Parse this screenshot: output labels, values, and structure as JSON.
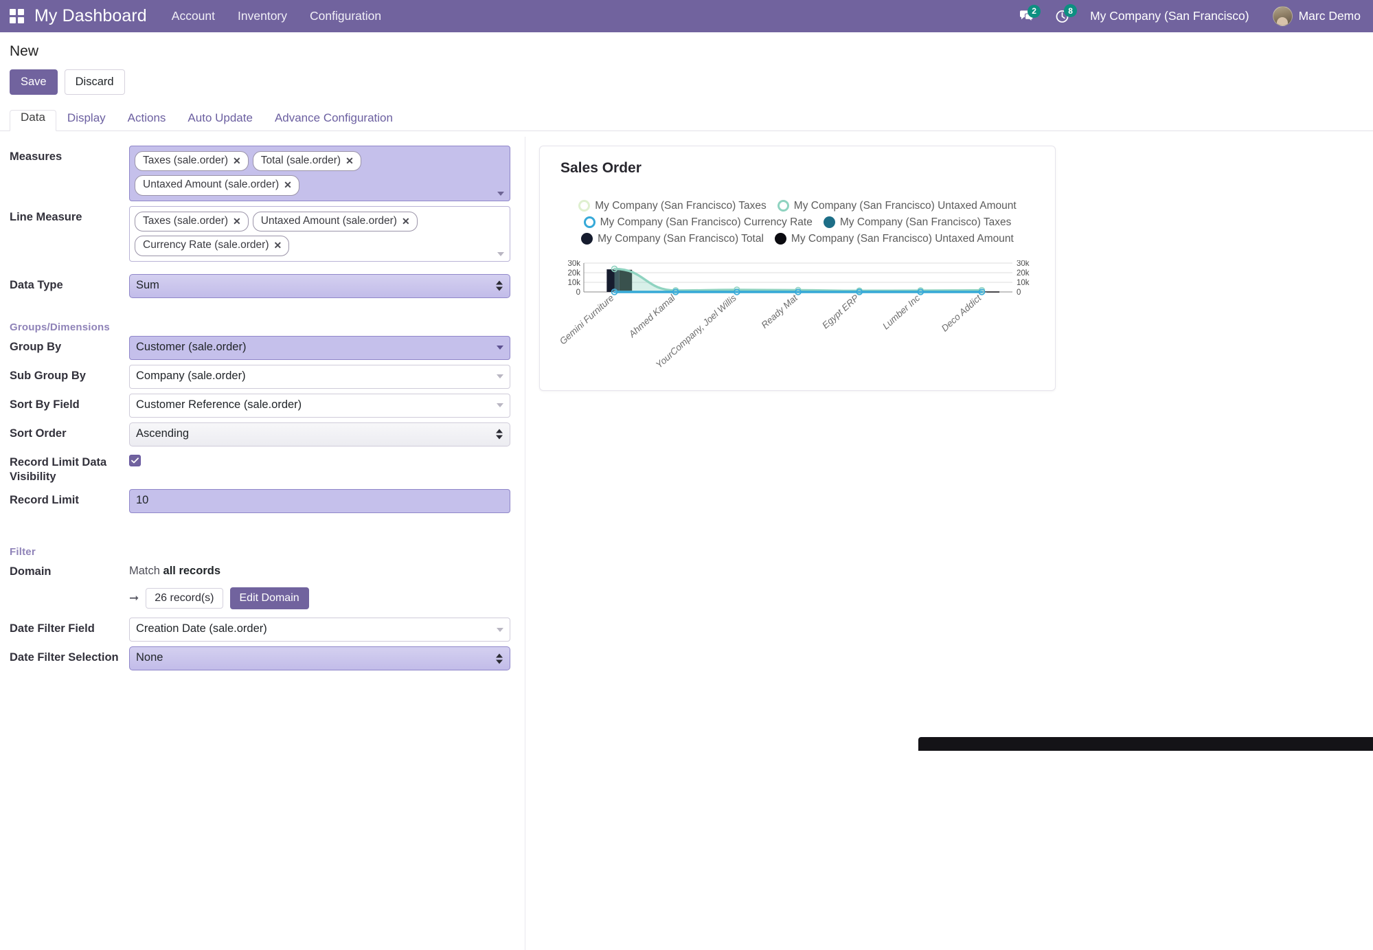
{
  "navbar": {
    "apps_icon": "apps-grid-icon",
    "brand": "My Dashboard",
    "menu": [
      {
        "label": "Account"
      },
      {
        "label": "Inventory"
      },
      {
        "label": "Configuration"
      }
    ],
    "messages_icon": "chat-bubble-icon",
    "messages_count": "2",
    "activity_icon": "clock-icon",
    "activity_count": "8",
    "company": "My Company (San Francisco)",
    "user_name": "Marc Demo",
    "avatar_icon": "user-avatar",
    "accent_color": "#71639e"
  },
  "control_panel": {
    "title": "New",
    "save_label": "Save",
    "discard_label": "Discard"
  },
  "tabs": [
    {
      "label": "Data",
      "active": true
    },
    {
      "label": "Display",
      "active": false
    },
    {
      "label": "Actions",
      "active": false
    },
    {
      "label": "Auto Update",
      "active": false
    },
    {
      "label": "Advance Configuration",
      "active": false
    }
  ],
  "form": {
    "measures": {
      "label": "Measures",
      "tags": [
        "Taxes (sale.order)",
        "Total (sale.order)",
        "Untaxed Amount (sale.order)"
      ],
      "remove_icon": "close-icon",
      "dropdown_icon": "chevron-down-icon"
    },
    "line_measure": {
      "label": "Line Measure",
      "tags": [
        "Taxes (sale.order)",
        "Untaxed Amount (sale.order)",
        "Currency Rate (sale.order)"
      ],
      "remove_icon": "close-icon",
      "dropdown_icon": "chevron-down-icon"
    },
    "data_type": {
      "label": "Data Type",
      "value": "Sum"
    },
    "groups_section": "Groups/Dimensions",
    "group_by": {
      "label": "Group By",
      "value": "Customer (sale.order)"
    },
    "sub_group_by": {
      "label": "Sub Group By",
      "value": "Company (sale.order)"
    },
    "sort_by_field": {
      "label": "Sort By Field",
      "value": "Customer Reference (sale.order)"
    },
    "sort_order": {
      "label": "Sort Order",
      "value": "Ascending"
    },
    "record_limit_visibility": {
      "label": "Record Limit Data Visibility",
      "checked": true,
      "check_icon": "checkmark-icon"
    },
    "record_limit": {
      "label": "Record Limit",
      "value": "10"
    },
    "filter_section": "Filter",
    "domain": {
      "label": "Domain",
      "match_prefix": "Match",
      "match_strong": "all records",
      "arrow_icon": "arrow-right-icon",
      "record_count": "26 record(s)",
      "edit_domain_label": "Edit Domain"
    },
    "date_filter_field": {
      "label": "Date Filter Field",
      "value": "Creation Date (sale.order)"
    },
    "date_filter_selection": {
      "label": "Date Filter Selection",
      "value": "None"
    }
  },
  "chart_card": {
    "title": "Sales Order"
  },
  "chart_data": {
    "type": "bar",
    "title": "Sales Order",
    "xlabel": "",
    "ylabel": "",
    "ylim": [
      0,
      30000
    ],
    "yticks": [
      0,
      10000,
      20000,
      30000
    ],
    "ytick_labels": [
      "0",
      "10k",
      "20k",
      "30k"
    ],
    "y2ticks": [
      0,
      10000,
      20000,
      30000
    ],
    "y2tick_labels": [
      "0",
      "10k",
      "20k",
      "30k"
    ],
    "grid": true,
    "legend_position": "top",
    "categories": [
      "Gemini Furniture",
      "Ahmed Kamal",
      "YourCompany, Joel Willis",
      "Ready Mat",
      "Egypt ERP",
      "Lumber Inc",
      "Deco Addict"
    ],
    "series": [
      {
        "name": "My Company (San Francisco) Taxes",
        "kind": "line",
        "color": "#dff0d0",
        "marker": "ring",
        "values": [
          0,
          0,
          0,
          0,
          0,
          0,
          0
        ]
      },
      {
        "name": "My Company (San Francisco) Untaxed Amount",
        "kind": "line",
        "color": "#8fd3c0",
        "marker": "ring",
        "values": [
          24000,
          1500,
          2200,
          1800,
          1200,
          1400,
          1700
        ]
      },
      {
        "name": "My Company (San Francisco) Currency Rate",
        "kind": "line",
        "color": "#36a9d8",
        "marker": "ring",
        "values": [
          0,
          0,
          0,
          0,
          0,
          0,
          0
        ]
      },
      {
        "name": "My Company (San Francisco) Taxes",
        "kind": "bar",
        "color": "#1d6e87",
        "marker": "solid",
        "values": [
          0,
          0,
          0,
          0,
          0,
          0,
          0
        ]
      },
      {
        "name": "My Company (San Francisco) Total",
        "kind": "bar",
        "color": "#161c2e",
        "marker": "solid",
        "values": [
          23500,
          0,
          800,
          300,
          0,
          0,
          600
        ]
      },
      {
        "name": "My Company (San Francisco) Untaxed Amount",
        "kind": "bar",
        "color": "#0b0b10",
        "marker": "solid",
        "values": [
          23000,
          0,
          700,
          250,
          0,
          0,
          500
        ]
      }
    ]
  }
}
